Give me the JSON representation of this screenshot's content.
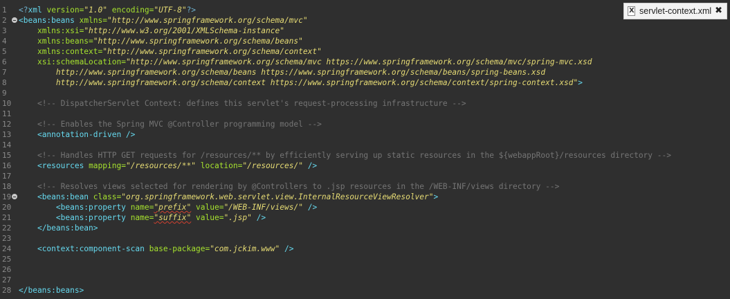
{
  "editor_tab": {
    "icon": "xml-file-icon",
    "icon_glyph": "X",
    "title": "servlet-context.xml",
    "close_glyph": "✖"
  },
  "colors": {
    "background": "#2f2f2f",
    "tag": "#66d9ef",
    "attribute": "#a6e22e",
    "value": "#e6db74",
    "comment": "#757575",
    "line_number": "#8a8a8a"
  },
  "lines": [
    {
      "n": "1",
      "fold": false,
      "segments": [
        {
          "c": "pi",
          "t": "<?"
        },
        {
          "c": "tag",
          "t": "xml"
        },
        {
          "c": "txt",
          "t": " "
        },
        {
          "c": "attr",
          "t": "version="
        },
        {
          "c": "val",
          "t": "\"1.0\""
        },
        {
          "c": "txt",
          "t": " "
        },
        {
          "c": "attr",
          "t": "encoding="
        },
        {
          "c": "val",
          "t": "\"UTF-8\""
        },
        {
          "c": "pi",
          "t": "?>"
        }
      ]
    },
    {
      "n": "2",
      "fold": true,
      "segments": [
        {
          "c": "tag",
          "t": "<beans:beans"
        },
        {
          "c": "txt",
          "t": " "
        },
        {
          "c": "attr",
          "t": "xmlns="
        },
        {
          "c": "val",
          "t": "\"http://www.springframework.org/schema/mvc\""
        }
      ]
    },
    {
      "n": "3",
      "fold": false,
      "segments": [
        {
          "c": "txt",
          "t": "    "
        },
        {
          "c": "attr",
          "t": "xmlns:xsi="
        },
        {
          "c": "val",
          "t": "\"http://www.w3.org/2001/XMLSchema-instance\""
        }
      ]
    },
    {
      "n": "4",
      "fold": false,
      "segments": [
        {
          "c": "txt",
          "t": "    "
        },
        {
          "c": "attr",
          "t": "xmlns:beans="
        },
        {
          "c": "val",
          "t": "\"http://www.springframework.org/schema/beans\""
        }
      ]
    },
    {
      "n": "5",
      "fold": false,
      "segments": [
        {
          "c": "txt",
          "t": "    "
        },
        {
          "c": "attr",
          "t": "xmlns:context="
        },
        {
          "c": "val",
          "t": "\"http://www.springframework.org/schema/context\""
        }
      ]
    },
    {
      "n": "6",
      "fold": false,
      "segments": [
        {
          "c": "txt",
          "t": "    "
        },
        {
          "c": "attr",
          "t": "xsi:schemaLocation="
        },
        {
          "c": "val",
          "t": "\"http://www.springframework.org/schema/mvc https://www.springframework.org/schema/mvc/spring-mvc.xsd"
        }
      ]
    },
    {
      "n": "7",
      "fold": false,
      "segments": [
        {
          "c": "txt",
          "t": "        "
        },
        {
          "c": "val",
          "t": "http://www.springframework.org/schema/beans https://www.springframework.org/schema/beans/spring-beans.xsd"
        }
      ]
    },
    {
      "n": "8",
      "fold": false,
      "segments": [
        {
          "c": "txt",
          "t": "        "
        },
        {
          "c": "val",
          "t": "http://www.springframework.org/schema/context https://www.springframework.org/schema/context/spring-context.xsd\""
        },
        {
          "c": "tag",
          "t": ">"
        }
      ]
    },
    {
      "n": "9",
      "fold": false,
      "segments": []
    },
    {
      "n": "10",
      "fold": false,
      "segments": [
        {
          "c": "txt",
          "t": "    "
        },
        {
          "c": "cmt",
          "t": "<!-- DispatcherServlet Context: defines this servlet's request-processing infrastructure -->"
        }
      ]
    },
    {
      "n": "11",
      "fold": false,
      "segments": []
    },
    {
      "n": "12",
      "fold": false,
      "segments": [
        {
          "c": "txt",
          "t": "    "
        },
        {
          "c": "cmt",
          "t": "<!-- Enables the Spring MVC @Controller programming model -->"
        }
      ]
    },
    {
      "n": "13",
      "fold": false,
      "segments": [
        {
          "c": "txt",
          "t": "    "
        },
        {
          "c": "tag",
          "t": "<annotation-driven />"
        }
      ]
    },
    {
      "n": "14",
      "fold": false,
      "segments": []
    },
    {
      "n": "15",
      "fold": false,
      "segments": [
        {
          "c": "txt",
          "t": "    "
        },
        {
          "c": "cmt",
          "t": "<!-- Handles HTTP GET requests for /resources/** by efficiently serving up static resources in the ${webappRoot}/resources directory -->"
        }
      ]
    },
    {
      "n": "16",
      "fold": false,
      "segments": [
        {
          "c": "txt",
          "t": "    "
        },
        {
          "c": "tag",
          "t": "<resources"
        },
        {
          "c": "txt",
          "t": " "
        },
        {
          "c": "attr",
          "t": "mapping="
        },
        {
          "c": "val",
          "t": "\"/resources/**\""
        },
        {
          "c": "txt",
          "t": " "
        },
        {
          "c": "attr",
          "t": "location="
        },
        {
          "c": "val",
          "t": "\"/resources/\""
        },
        {
          "c": "txt",
          "t": " "
        },
        {
          "c": "tag",
          "t": "/>"
        }
      ]
    },
    {
      "n": "17",
      "fold": false,
      "segments": []
    },
    {
      "n": "18",
      "fold": false,
      "segments": [
        {
          "c": "txt",
          "t": "    "
        },
        {
          "c": "cmt",
          "t": "<!-- Resolves views selected for rendering by @Controllers to .jsp resources in the /WEB-INF/views directory -->"
        }
      ]
    },
    {
      "n": "19",
      "fold": true,
      "segments": [
        {
          "c": "txt",
          "t": "    "
        },
        {
          "c": "tag",
          "t": "<beans:bean"
        },
        {
          "c": "txt",
          "t": " "
        },
        {
          "c": "attr",
          "t": "class="
        },
        {
          "c": "val",
          "t": "\"org.springframework.web.servlet.view.InternalResourceViewResolver\""
        },
        {
          "c": "tag",
          "t": ">"
        }
      ]
    },
    {
      "n": "20",
      "fold": false,
      "segments": [
        {
          "c": "txt",
          "t": "        "
        },
        {
          "c": "tag",
          "t": "<beans:property"
        },
        {
          "c": "txt",
          "t": " "
        },
        {
          "c": "attr",
          "t": "name="
        },
        {
          "c": "val sq",
          "t": "\"prefix\""
        },
        {
          "c": "txt",
          "t": " "
        },
        {
          "c": "attr",
          "t": "value="
        },
        {
          "c": "val",
          "t": "\"/WEB-INF/views/\""
        },
        {
          "c": "txt",
          "t": " "
        },
        {
          "c": "tag",
          "t": "/>"
        }
      ]
    },
    {
      "n": "21",
      "fold": false,
      "segments": [
        {
          "c": "txt",
          "t": "        "
        },
        {
          "c": "tag",
          "t": "<beans:property"
        },
        {
          "c": "txt",
          "t": " "
        },
        {
          "c": "attr",
          "t": "name="
        },
        {
          "c": "val sq",
          "t": "\"suffix\""
        },
        {
          "c": "txt",
          "t": " "
        },
        {
          "c": "attr",
          "t": "value="
        },
        {
          "c": "val",
          "t": "\".jsp\""
        },
        {
          "c": "txt",
          "t": " "
        },
        {
          "c": "tag",
          "t": "/>"
        }
      ]
    },
    {
      "n": "22",
      "fold": false,
      "segments": [
        {
          "c": "txt",
          "t": "    "
        },
        {
          "c": "tag",
          "t": "</beans:bean>"
        }
      ]
    },
    {
      "n": "23",
      "fold": false,
      "segments": []
    },
    {
      "n": "24",
      "fold": false,
      "segments": [
        {
          "c": "txt",
          "t": "    "
        },
        {
          "c": "tag",
          "t": "<context:component-scan"
        },
        {
          "c": "txt",
          "t": " "
        },
        {
          "c": "attr",
          "t": "base-package="
        },
        {
          "c": "val",
          "t": "\"com.jckim.www\""
        },
        {
          "c": "txt",
          "t": " "
        },
        {
          "c": "tag",
          "t": "/>"
        }
      ]
    },
    {
      "n": "25",
      "fold": false,
      "segments": []
    },
    {
      "n": "26",
      "fold": false,
      "segments": []
    },
    {
      "n": "27",
      "fold": false,
      "segments": []
    },
    {
      "n": "28",
      "fold": false,
      "segments": [
        {
          "c": "tag",
          "t": "</beans:beans>"
        }
      ]
    }
  ]
}
